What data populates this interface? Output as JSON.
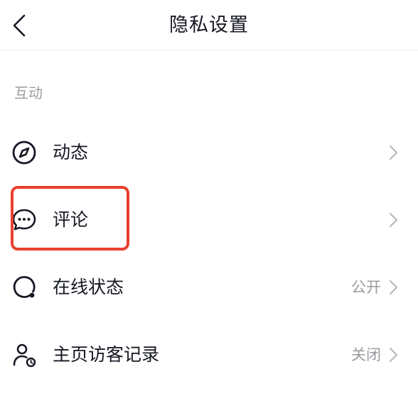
{
  "header": {
    "title": "隐私设置",
    "back_icon": "chevron-left-icon"
  },
  "section": {
    "label": "互动"
  },
  "rows": [
    {
      "label": "动态",
      "value": "",
      "icon": "compass-icon"
    },
    {
      "label": "评论",
      "value": "",
      "icon": "comment-bubble-icon"
    },
    {
      "label": "在线状态",
      "value": "公开",
      "icon": "online-status-icon"
    },
    {
      "label": "主页访客记录",
      "value": "关闭",
      "icon": "profile-visitor-icon"
    }
  ],
  "colors": {
    "text_primary": "#161823",
    "text_secondary": "#9a9aa0",
    "chevron": "#b8b8bd",
    "highlight": "#e84030"
  },
  "highlighted_row": "评论"
}
